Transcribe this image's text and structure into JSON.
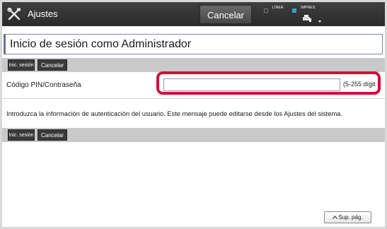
{
  "header": {
    "app_title": "Ajustes",
    "cancel_label": "Cancelar",
    "status": {
      "line_label": "LÍNEA",
      "print_label": "IMPRES."
    }
  },
  "page": {
    "title": "Inicio de sesión como Administrador"
  },
  "actions": {
    "login_label": "Inic. sesión",
    "cancel_label": "Cancelar"
  },
  "form": {
    "pin_label": "Código PIN/Contraseña",
    "pin_value": "",
    "pin_hint": "(5-255 dígit"
  },
  "info_message": "Introduzca la información de autenticación del usuario. Este mensaje puede editarse desde los Ajustes del sistema.",
  "footer": {
    "page_up_label": "Sup. pág."
  },
  "colors": {
    "highlight": "#d10f3d",
    "topbar": "#2f2f2f",
    "status_line": "#4d4d4d",
    "status_print": "#3aa0c8"
  }
}
